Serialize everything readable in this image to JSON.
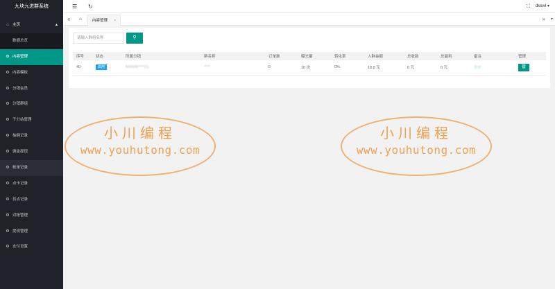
{
  "app": {
    "title": "九块九进群系统"
  },
  "sidebar": {
    "home_label": "主页",
    "items": [
      {
        "label": "数据总览"
      },
      {
        "label": "内容管理"
      },
      {
        "label": "内容模板"
      },
      {
        "label": "分销会员"
      },
      {
        "label": "分销群组"
      },
      {
        "label": "子分站管理"
      },
      {
        "label": "抽佣记录"
      },
      {
        "label": "佣金提现"
      },
      {
        "label": "帐单记录"
      },
      {
        "label": "点卡记录"
      },
      {
        "label": "扣点记录"
      },
      {
        "label": "对帐管理"
      },
      {
        "label": "提现管理"
      },
      {
        "label": "支付设置"
      }
    ]
  },
  "header": {
    "username": "dkewl"
  },
  "tabs": [
    {
      "label": "内容管理"
    }
  ],
  "search": {
    "placeholder": "请输入群组名称"
  },
  "table": {
    "columns": [
      "序号",
      "状态",
      "所属分销",
      "群名称",
      "订单数",
      "曝光量",
      "转化率",
      "入群金额",
      "总收款",
      "总赢利",
      "备注",
      "管理"
    ],
    "rows": [
      {
        "id": "40",
        "status": "启用",
        "distributor": "666666****(1)",
        "group_name": "****",
        "orders": "0",
        "exposure": "10 次",
        "conversion": "0%",
        "fee": "18.8 元",
        "total_received": "0 元",
        "total_profit": "0 元",
        "remark": "",
        "manage": "管"
      }
    ]
  },
  "watermark": {
    "cn": "小川编程",
    "url": "www.youhutong.com"
  },
  "colors": {
    "sidebar_bg": "#20222a",
    "accent": "#009688",
    "badge": "#1e9fff",
    "watermark": "#f0a050"
  }
}
